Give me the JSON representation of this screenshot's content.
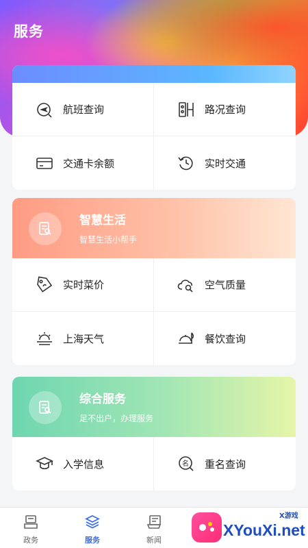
{
  "header": {
    "title": "服务"
  },
  "transport": {
    "items": [
      {
        "label": "航班查询",
        "icon": "plane-search-icon"
      },
      {
        "label": "路况查询",
        "icon": "road-condition-icon"
      },
      {
        "label": "交通卡余额",
        "icon": "transit-card-icon"
      },
      {
        "label": "实时交通",
        "icon": "clock-history-icon"
      }
    ]
  },
  "life": {
    "title": "智慧生活",
    "subtitle": "智慧生活小帮手",
    "items": [
      {
        "label": "实时菜价",
        "icon": "price-tag-icon"
      },
      {
        "label": "空气质量",
        "icon": "cloud-search-icon"
      },
      {
        "label": "上海天气",
        "icon": "weather-icon"
      },
      {
        "label": "餐饮查询",
        "icon": "dining-icon"
      }
    ]
  },
  "general": {
    "title": "综合服务",
    "subtitle": "足不出户，办理服务",
    "items": [
      {
        "label": "入学信息",
        "icon": "graduation-cap-icon"
      },
      {
        "label": "重名查询",
        "icon": "name-search-icon"
      }
    ]
  },
  "tabs": [
    {
      "label": "政务",
      "icon": "gov-icon",
      "active": false
    },
    {
      "label": "服务",
      "icon": "layers-icon",
      "active": true
    },
    {
      "label": "新闻",
      "icon": "news-icon",
      "active": false
    }
  ],
  "watermark": {
    "text": "XYouXi.net",
    "small": "X游戏"
  },
  "colors": {
    "accent": "#3a6ee8",
    "life_header": "#ff9b83",
    "general_header": "#6ed6b0"
  }
}
